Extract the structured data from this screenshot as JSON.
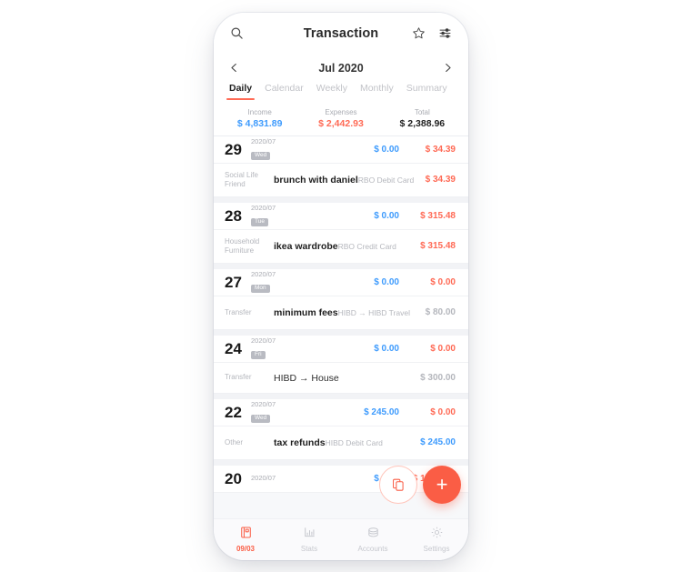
{
  "header": {
    "title": "Transaction",
    "search_icon": "search-icon",
    "star_icon": "star-icon",
    "filter_icon": "sliders-filter-icon"
  },
  "month_nav": {
    "prev_icon": "chevron-left-icon",
    "label": "Jul 2020",
    "next_icon": "chevron-right-icon"
  },
  "tabs": [
    {
      "label": "Daily",
      "active": true
    },
    {
      "label": "Calendar",
      "active": false
    },
    {
      "label": "Weekly",
      "active": false
    },
    {
      "label": "Monthly",
      "active": false
    },
    {
      "label": "Summary",
      "active": false
    }
  ],
  "summary": {
    "income_label": "Income",
    "income_value": "$ 4,831.89",
    "expenses_label": "Expenses",
    "expenses_value": "$ 2,442.93",
    "total_label": "Total",
    "total_value": "$ 2,388.96"
  },
  "groups": [
    {
      "day": "29",
      "date": "2020/07",
      "weekday": "Wed",
      "income": "$ 0.00",
      "expense": "$ 34.39",
      "transactions": [
        {
          "category_line1": "Social Life",
          "category_line2": "Friend",
          "title": "brunch with daniel",
          "subtitle": "RBO Debit Card",
          "amount": "$ 34.39",
          "amount_type": "expense",
          "single_line": false
        }
      ]
    },
    {
      "day": "28",
      "date": "2020/07",
      "weekday": "Tue",
      "income": "$ 0.00",
      "expense": "$ 315.48",
      "transactions": [
        {
          "category_line1": "Household",
          "category_line2": "Furniture",
          "title": "ikea wardrobe",
          "subtitle": "RBO Credit Card",
          "amount": "$ 315.48",
          "amount_type": "expense",
          "single_line": false
        }
      ]
    },
    {
      "day": "27",
      "date": "2020/07",
      "weekday": "Mon",
      "income": "$ 0.00",
      "expense": "$ 0.00",
      "transactions": [
        {
          "category_line1": "Transfer",
          "category_line2": "",
          "title": "minimum fees",
          "subtitle": "HIBD → HIBD Travel",
          "amount": "$ 80.00",
          "amount_type": "neutral",
          "single_line": false
        }
      ]
    },
    {
      "day": "24",
      "date": "2020/07",
      "weekday": "Fri",
      "income": "$ 0.00",
      "expense": "$ 0.00",
      "transactions": [
        {
          "category_line1": "Transfer",
          "category_line2": "",
          "title": "HIBD → House",
          "subtitle": "",
          "amount": "$ 300.00",
          "amount_type": "neutral",
          "single_line": true
        }
      ]
    },
    {
      "day": "22",
      "date": "2020/07",
      "weekday": "Wed",
      "income": "$ 245.00",
      "expense": "$ 0.00",
      "transactions": [
        {
          "category_line1": "Other",
          "category_line2": "",
          "title": "tax refunds",
          "subtitle": "HIBD Debit Card",
          "amount": "$ 245.00",
          "amount_type": "income",
          "single_line": false
        }
      ]
    },
    {
      "day": "20",
      "date": "2020/07",
      "weekday": "",
      "income": "$ 0.00",
      "expense": "$ 1,241.77",
      "transactions": []
    }
  ],
  "floating": {
    "copy_icon": "copy-icon",
    "add_label": "+"
  },
  "bottom_nav": [
    {
      "label": "09/03",
      "icon": "ledger-book-icon",
      "active": true
    },
    {
      "label": "Stats",
      "icon": "bar-chart-icon",
      "active": false
    },
    {
      "label": "Accounts",
      "icon": "coins-stack-icon",
      "active": false
    },
    {
      "label": "Settings",
      "icon": "gear-icon",
      "active": false
    }
  ],
  "colors": {
    "accent": "#fa5d45",
    "expense": "#ff6a55",
    "income": "#3e9bfd",
    "muted": "#b5b7bd"
  }
}
